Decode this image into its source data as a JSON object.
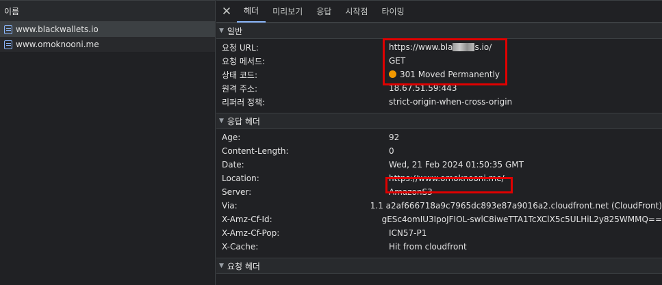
{
  "left_pane": {
    "header": "이름",
    "requests": [
      {
        "name": "www.blackwallets.io"
      },
      {
        "name": "www.omoknooni.me"
      }
    ]
  },
  "tabs": {
    "close_glyph": "✕",
    "items": [
      {
        "label": "헤더"
      },
      {
        "label": "미리보기"
      },
      {
        "label": "응답"
      },
      {
        "label": "시작점"
      },
      {
        "label": "타이밍"
      }
    ]
  },
  "general": {
    "title": "일반",
    "request_url_label": "요청 URL:",
    "request_url_prefix": "https://www.bla",
    "request_url_suffix": "s.io/",
    "request_method_label": "요청 메서드:",
    "request_method": "GET",
    "status_code_label": "상태 코드:",
    "status_code": "301 Moved Permanently",
    "status_color": "#f29900",
    "remote_address_label": "원격 주소:",
    "remote_address": "18.67.51.59:443",
    "referrer_policy_label": "리퍼러 정책:",
    "referrer_policy": "strict-origin-when-cross-origin"
  },
  "response_headers": {
    "title": "응답 헤더",
    "rows": [
      {
        "key": "Age:",
        "value": "92"
      },
      {
        "key": "Content-Length:",
        "value": "0"
      },
      {
        "key": "Date:",
        "value": "Wed, 21 Feb 2024 01:50:35 GMT"
      },
      {
        "key": "Location:",
        "value": "https://www.omoknooni.me/"
      },
      {
        "key": "Server:",
        "value": "AmazonS3"
      },
      {
        "key": "Via:",
        "value": "1.1 a2af666718a9c7965dc893e87a9016a2.cloudfront.net (CloudFront)"
      },
      {
        "key": "X-Amz-Cf-Id:",
        "value": "gESc4omIU3IpoJFIOL-swlC8iweTTA1TcXClX5c5ULHiL2y825WMMQ=="
      },
      {
        "key": "X-Amz-Cf-Pop:",
        "value": "ICN57-P1"
      },
      {
        "key": "X-Cache:",
        "value": "Hit from cloudfront"
      }
    ]
  },
  "request_headers": {
    "title": "요청 헤더"
  },
  "colors": {
    "accent": "#8ab4f8",
    "highlight_box": "#e00000"
  }
}
